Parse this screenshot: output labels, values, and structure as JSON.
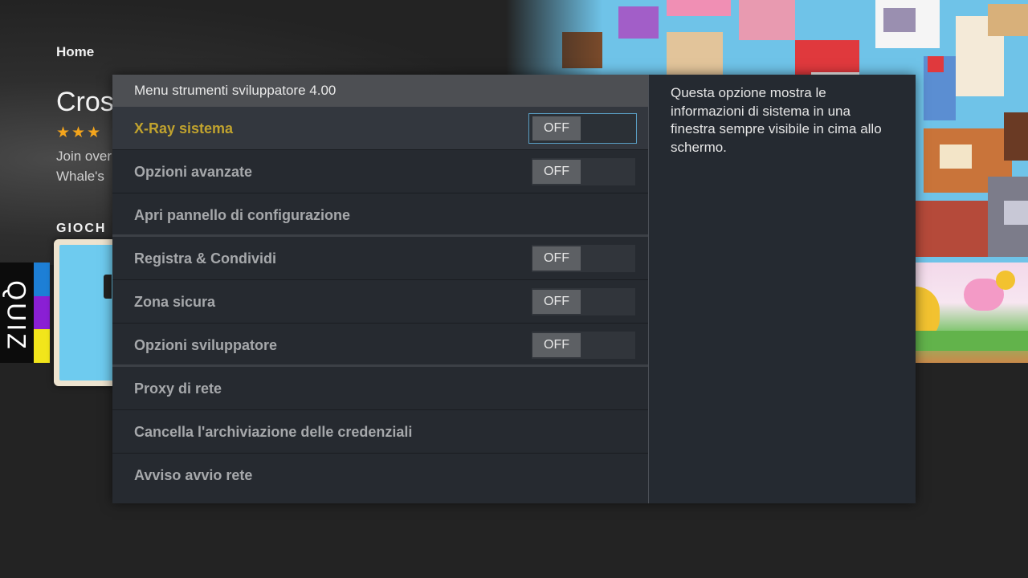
{
  "home": {
    "nav_label": "Home",
    "hero_title": "Cross",
    "rating_stars": "★★★",
    "desc_line1": "Join over",
    "desc_line2": "Whale's",
    "section_title": "GIOCH",
    "quiz_tile_text": "QUIZ"
  },
  "dev_menu": {
    "title": "Menu strumenti sviluppatore 4.00",
    "items": [
      {
        "label": "X-Ray sistema",
        "toggle": "OFF",
        "selected": true
      },
      {
        "label": "Opzioni avanzate",
        "toggle": "OFF"
      },
      {
        "label": "Apri pannello di configurazione"
      },
      {
        "label": "Registra & Condividi",
        "toggle": "OFF"
      },
      {
        "label": "Zona sicura",
        "toggle": "OFF"
      },
      {
        "label": "Opzioni sviluppatore",
        "toggle": "OFF"
      },
      {
        "label": "Proxy di rete"
      },
      {
        "label": "Cancella l'archiviazione delle credenziali"
      },
      {
        "label": "Avviso avvio rete"
      }
    ],
    "description": "Questa opzione mostra le informazioni di sistema in una finestra sempre visibile in cima allo schermo."
  },
  "colors": {
    "selected_text": "#c1a32e",
    "focus_border": "#5a9ec4",
    "star": "#f4a51c",
    "quiz_bars": [
      "#1d7fd6",
      "#8a1fd4",
      "#f2e51b"
    ]
  }
}
